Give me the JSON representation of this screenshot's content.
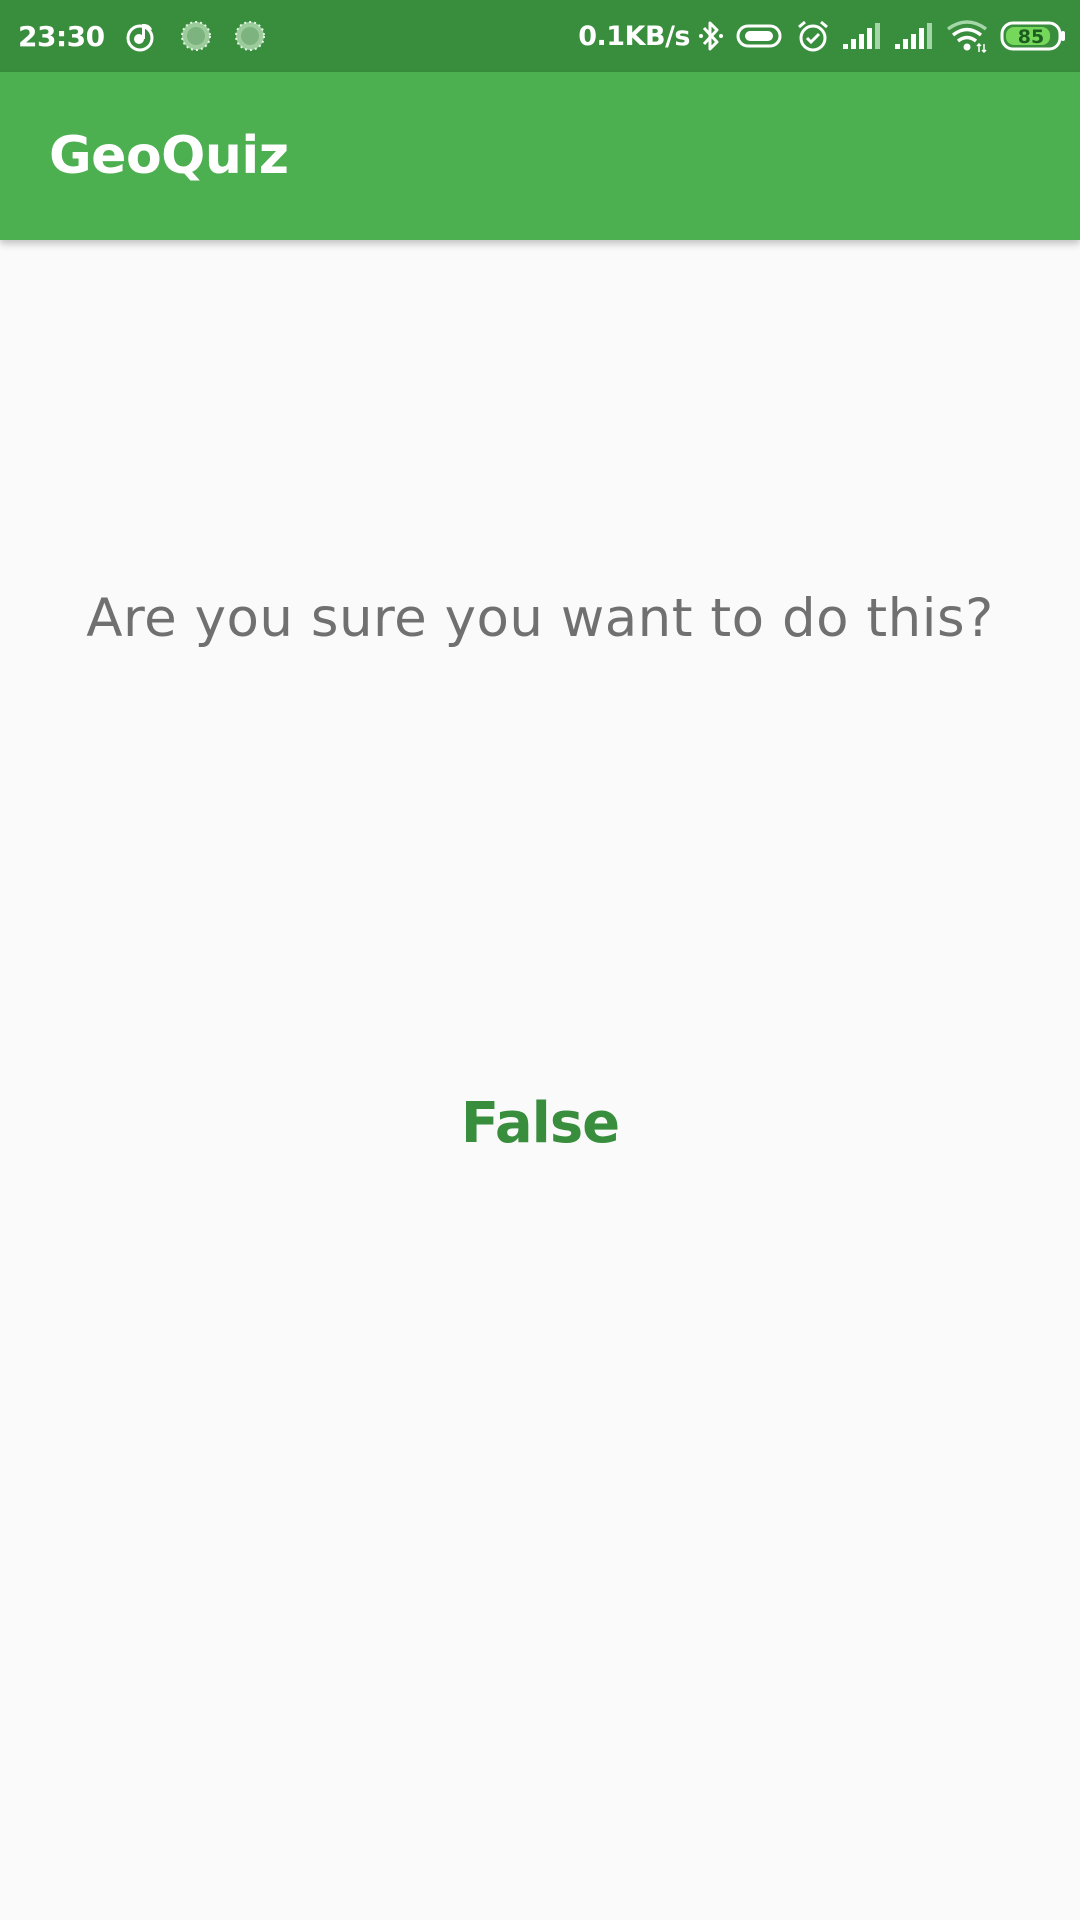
{
  "status_bar": {
    "time": "23:30",
    "net_speed": "0.1KB/s",
    "battery_level": "85",
    "background_color": "#388E3C",
    "left_icons": [
      "music-note-icon",
      "loading-spinner-icon",
      "loading-spinner-icon"
    ],
    "right_icons": [
      "bluetooth-icon",
      "vibrate-icon",
      "alarm-icon",
      "signal-icon",
      "signal-icon",
      "wifi-icon",
      "battery-icon"
    ]
  },
  "app_bar": {
    "title": "GeoQuiz",
    "background_color": "#4CAF50"
  },
  "main": {
    "question": "Are you sure you want to do this?",
    "answer_button_label": "False",
    "answer_color": "#388E3C"
  }
}
